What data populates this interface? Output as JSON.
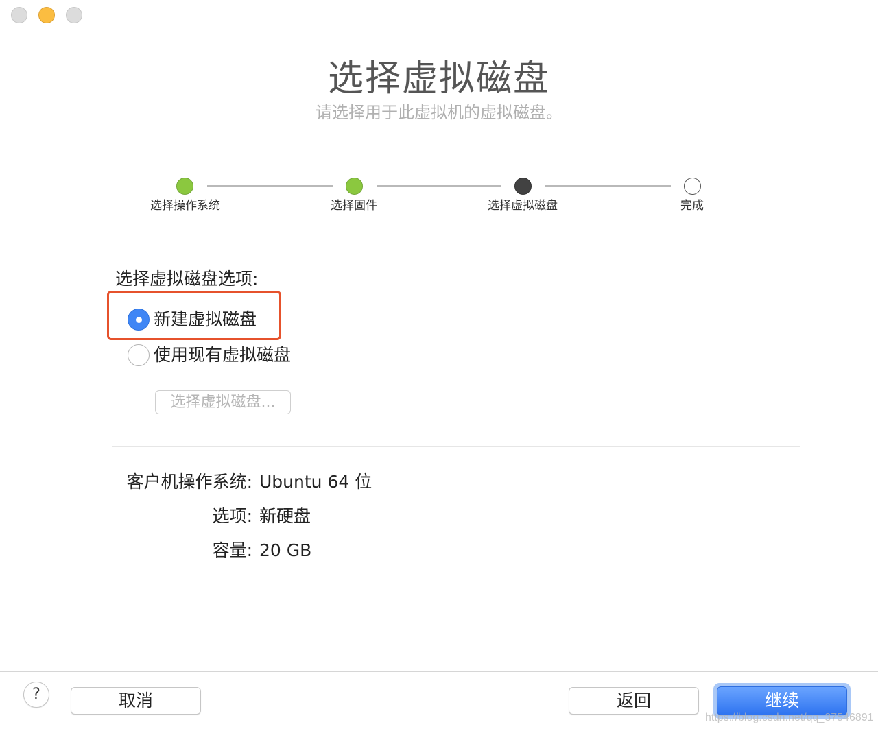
{
  "window": {
    "title": "选择虚拟磁盘",
    "subtitle": "请选择用于此虚拟机的虚拟磁盘。"
  },
  "steps": [
    {
      "label": "选择操作系统",
      "state": "done"
    },
    {
      "label": "选择固件",
      "state": "done"
    },
    {
      "label": "选择虚拟磁盘",
      "state": "current"
    },
    {
      "label": "完成",
      "state": "todo"
    }
  ],
  "colors": {
    "step_done": "#8bc83f",
    "step_current": "#424242",
    "highlight": "#e6522c",
    "accent": "#3f86f5"
  },
  "disk_options": {
    "label": "选择虚拟磁盘选项:",
    "selected": "new",
    "new_label": "新建虚拟磁盘",
    "existing_label": "使用现有虚拟磁盘",
    "choose_button": "选择虚拟磁盘..."
  },
  "summary": {
    "os_label": "客户机操作系统:",
    "os_value": "Ubuntu 64 位",
    "option_label": "选项:",
    "option_value": "新硬盘",
    "capacity_label": "容量:",
    "capacity_value": "20 GB"
  },
  "footer": {
    "help": "?",
    "cancel": "取消",
    "back": "返回",
    "continue": "继续"
  },
  "watermark": "https://blog.csdn.net/qq_37546891"
}
